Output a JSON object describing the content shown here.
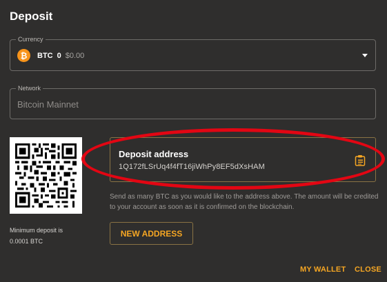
{
  "dialog": {
    "title": "Deposit"
  },
  "currency": {
    "label": "Currency",
    "logo_glyph": "₿",
    "code": "BTC",
    "amount": "0",
    "fiat_value": "$0.00"
  },
  "network": {
    "label": "Network",
    "value": "Bitcoin Mainnet"
  },
  "deposit": {
    "address_title": "Deposit address",
    "address": "1Q172fLSrUq4f4fT16jiWhPy8EF5dXsHAM",
    "help_text": "Send as many BTC as you would like to the address above. The amount will be credited to your account as soon as it is confirmed on the blockchain.",
    "minimum_label": "Minimum deposit is",
    "minimum_value": "0.0001 BTC",
    "new_address_label": "NEW ADDRESS"
  },
  "footer": {
    "my_wallet_label": "MY WALLET",
    "close_label": "CLOSE"
  },
  "colors": {
    "background": "#2f2e2d",
    "accent": "#f5a623",
    "btc_orange": "#f7931a",
    "annotation_red": "#e30613"
  },
  "icons": {
    "currency": "bitcoin-logo-icon",
    "dropdown": "chevron-down-icon",
    "copy": "clipboard-copy-icon",
    "qr": "qr-code"
  }
}
